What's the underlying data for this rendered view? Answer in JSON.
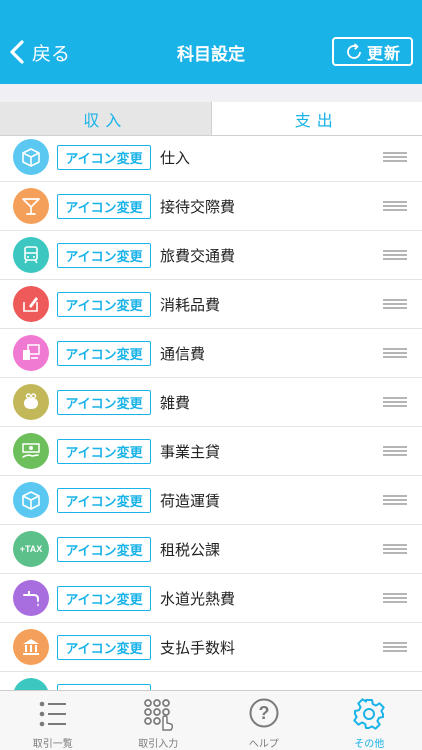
{
  "header": {
    "back_label": "戻る",
    "title": "科目設定",
    "update_label": "更新"
  },
  "segments": [
    {
      "label": "収入",
      "active": false
    },
    {
      "label": "支出",
      "active": true
    }
  ],
  "change_icon_label": "アイコン変更",
  "rows": [
    {
      "label": "仕入",
      "icon": "box-icon",
      "color": "#5bc8f2"
    },
    {
      "label": "接待交際費",
      "icon": "cocktail-icon",
      "color": "#f5a05a"
    },
    {
      "label": "旅費交通費",
      "icon": "train-icon",
      "color": "#3cc8c0"
    },
    {
      "label": "消耗品費",
      "icon": "pen-box-icon",
      "color": "#ee5a5a"
    },
    {
      "label": "通信費",
      "icon": "computer-icon",
      "color": "#f07ad2"
    },
    {
      "label": "雑費",
      "icon": "purse-icon",
      "color": "#c2b85a"
    },
    {
      "label": "事業主貸",
      "icon": "money-hand-icon",
      "color": "#6cbf5a"
    },
    {
      "label": "荷造運賃",
      "icon": "box-icon",
      "color": "#5bc8f2"
    },
    {
      "label": "租税公課",
      "icon": "tax-icon",
      "color": "#5cc08a",
      "text": "+TAX"
    },
    {
      "label": "水道光熱費",
      "icon": "faucet-icon",
      "color": "#a86ee0"
    },
    {
      "label": "支払手数料",
      "icon": "bank-icon",
      "color": "#f5a05a"
    },
    {
      "label": "",
      "icon": "partial-icon",
      "color": "#3cc8c0"
    }
  ],
  "tabbar": [
    {
      "label": "取引一覧",
      "icon": "list-icon",
      "active": false
    },
    {
      "label": "取引入力",
      "icon": "keypad-icon",
      "active": false
    },
    {
      "label": "ヘルプ",
      "icon": "help-icon",
      "active": false
    },
    {
      "label": "その他",
      "icon": "gear-icon",
      "active": true
    }
  ]
}
